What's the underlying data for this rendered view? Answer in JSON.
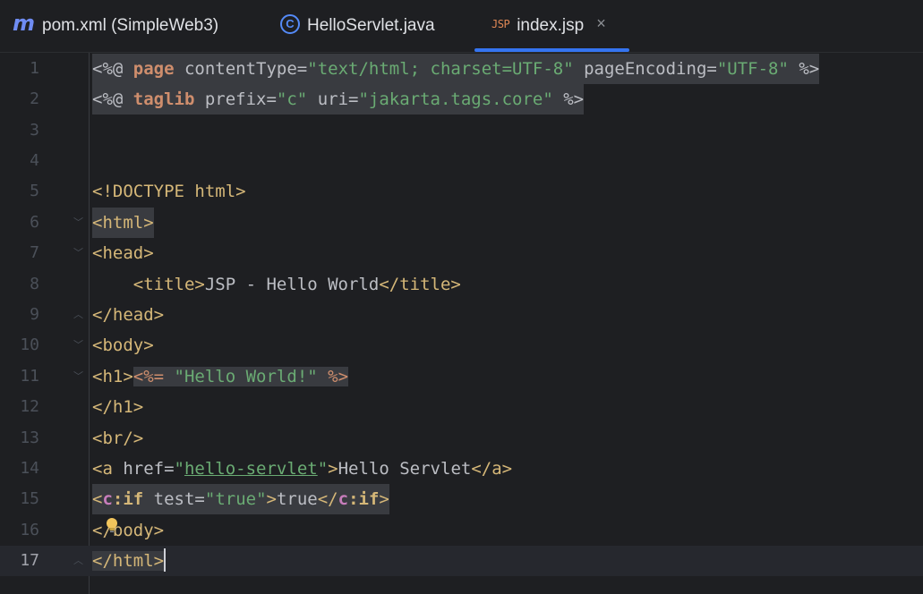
{
  "tabs": [
    {
      "label": "pom.xml (SimpleWeb3)",
      "icon": "maven-icon"
    },
    {
      "label": "HelloServlet.java",
      "icon": "java-class-icon"
    },
    {
      "label": "index.jsp",
      "icon": "jsp-file-icon",
      "active": true
    }
  ],
  "icons": {
    "maven": "m",
    "java_class": "C",
    "jsp": "JSP",
    "close": "×"
  },
  "line_numbers": [
    "1",
    "2",
    "3",
    "4",
    "5",
    "6",
    "7",
    "8",
    "9",
    "10",
    "11",
    "12",
    "13",
    "14",
    "15",
    "16",
    "17"
  ],
  "code": {
    "l1": {
      "a": "<%@ ",
      "b": "page",
      "c": " contentType=",
      "d": "\"text/html; charset=UTF-8\"",
      "e": " pageEncoding=",
      "f": "\"UTF-8\"",
      "g": " %>"
    },
    "l2": {
      "a": "<%@ ",
      "b": "taglib",
      "c": " prefix=",
      "d": "\"c\"",
      "e": " uri=",
      "f": "\"jakarta.tags.core\"",
      "g": " %>"
    },
    "l5": "<!DOCTYPE html>",
    "l6": "<html>",
    "l7": "<head>",
    "l8": {
      "a": "    <title>",
      "b": "JSP - Hello World",
      "c": "</title>"
    },
    "l9": "</head>",
    "l10": "<body>",
    "l11": {
      "a": "<h1>",
      "b": "<%=",
      "c": " ",
      "d": "\"Hello World!\"",
      "e": " %>"
    },
    "l12": "</h1>",
    "l13": "<br/>",
    "l14": {
      "a": "<a",
      "b": " href=",
      "c": "\"",
      "d": "hello-servlet",
      "e": "\"",
      "f": ">",
      "g": "Hello Servlet",
      "h": "</a>"
    },
    "l15": {
      "a": "<",
      "b": "c",
      "c": ":if",
      "d": " test=",
      "e": "\"true\"",
      "f": ">",
      "g": "true",
      "h": "</",
      "i": "c",
      "j": ":if",
      "k": ">"
    },
    "l16": "</body>",
    "l17": "</html>"
  },
  "colors": {
    "background": "#1e1f22",
    "active_tab_indicator": "#3574f0",
    "tag": "#d5b778",
    "string": "#6aab73",
    "directive": "#cf8e6d"
  }
}
